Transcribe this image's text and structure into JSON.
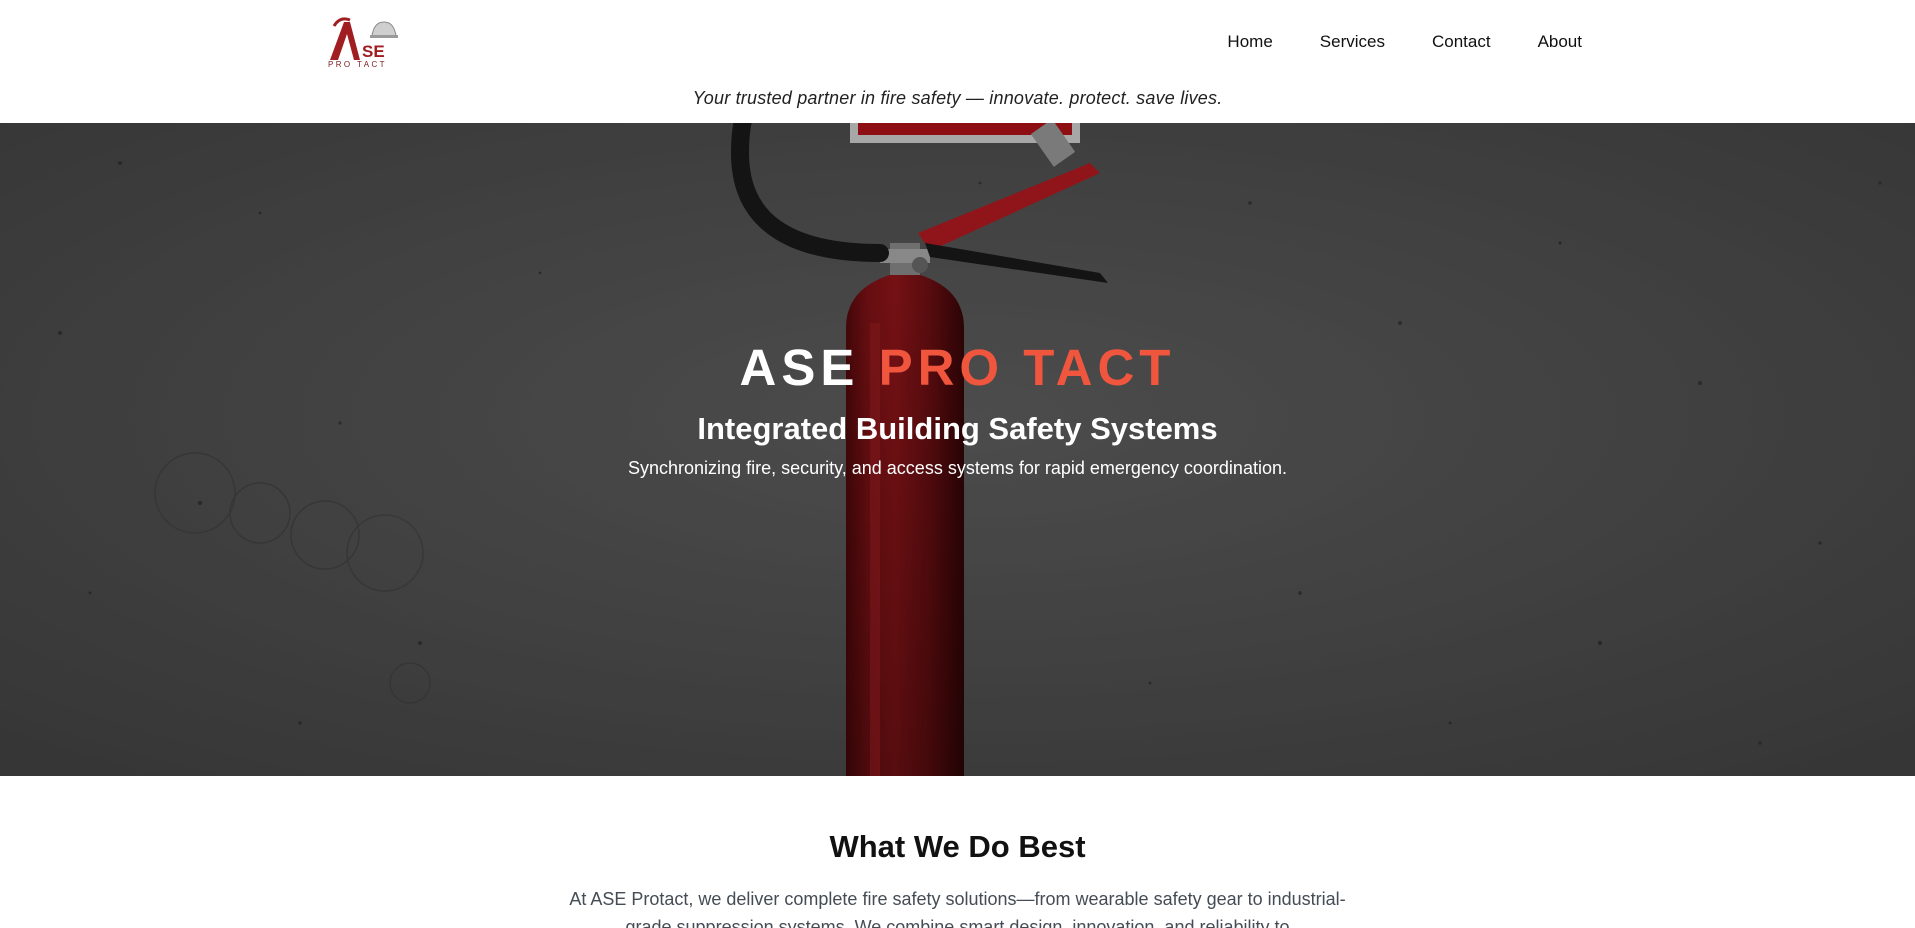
{
  "brand": {
    "logo_letters": "ASE",
    "logo_sub": "PRO TACT",
    "colors": {
      "accent": "#f0553d",
      "logo_red": "#a01e22"
    }
  },
  "nav": {
    "items": [
      {
        "label": "Home"
      },
      {
        "label": "Services"
      },
      {
        "label": "Contact"
      },
      {
        "label": "About"
      }
    ]
  },
  "tagline": "Your trusted partner in fire safety — innovate. protect. save lives.",
  "hero": {
    "title_white": "ASE",
    "title_red": "PRO TACT",
    "subtitle": "Integrated Building Safety Systems",
    "description": "Synchronizing fire, security, and access systems for rapid emergency coordination.",
    "image_subject": "red fire extinguisher against concrete wall"
  },
  "section": {
    "title": "What We Do Best",
    "text": "At ASE Protact, we deliver complete fire safety solutions—from wearable safety gear to industrial-grade suppression systems. We combine smart design, innovation, and reliability to"
  }
}
